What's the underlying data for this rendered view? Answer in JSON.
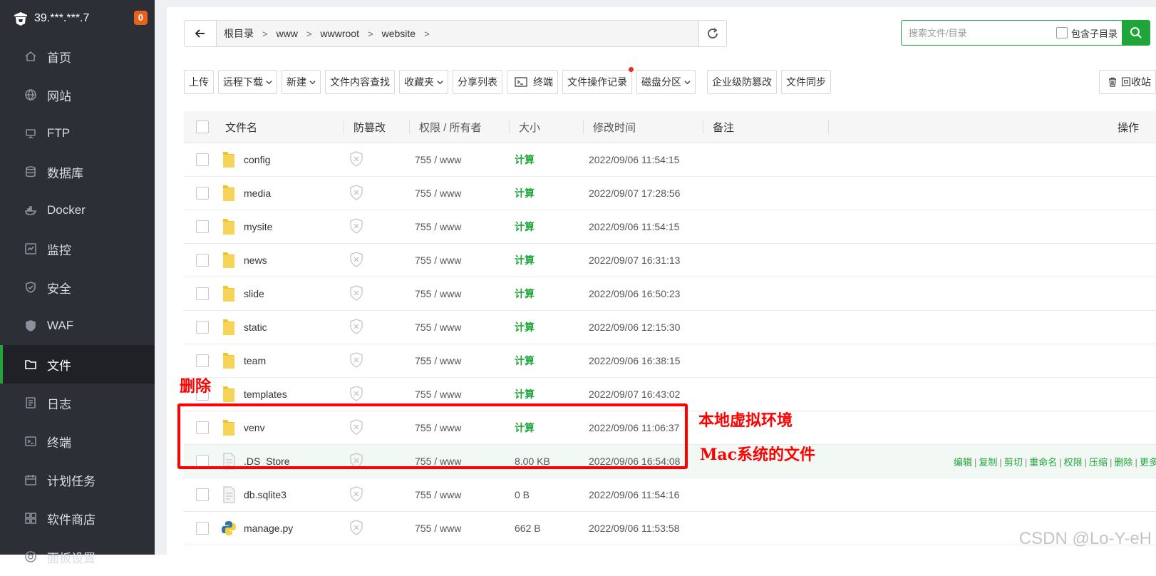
{
  "sidebar": {
    "server_ip": "39.***.***.7",
    "badge": "0",
    "items": [
      {
        "label": "首页",
        "icon": "home-icon"
      },
      {
        "label": "网站",
        "icon": "globe-icon"
      },
      {
        "label": "FTP",
        "icon": "ftp-icon"
      },
      {
        "label": "数据库",
        "icon": "database-icon"
      },
      {
        "label": "Docker",
        "icon": "docker-icon"
      },
      {
        "label": "监控",
        "icon": "monitor-icon"
      },
      {
        "label": "安全",
        "icon": "shield-icon"
      },
      {
        "label": "WAF",
        "icon": "waf-shield-icon"
      },
      {
        "label": "文件",
        "icon": "folder-icon"
      },
      {
        "label": "日志",
        "icon": "log-icon"
      },
      {
        "label": "终端",
        "icon": "terminal-icon"
      },
      {
        "label": "计划任务",
        "icon": "calendar-icon"
      },
      {
        "label": "软件商店",
        "icon": "apps-icon"
      },
      {
        "label": "面板设置",
        "icon": "settings-icon"
      }
    ],
    "active_index": 8
  },
  "path": {
    "crumbs": [
      "根目录",
      "www",
      "wwwroot",
      "website"
    ]
  },
  "search": {
    "placeholder": "搜索文件/目录",
    "include_sub": "包含子目录"
  },
  "toolbar": {
    "upload": "上传",
    "remote_download": "远程下载",
    "new": "新建",
    "content_search": "文件内容查找",
    "favorites": "收藏夹",
    "share_list": "分享列表",
    "terminal": "终端",
    "op_log": "文件操作记录",
    "disk": "磁盘分区",
    "tamper": "企业级防篡改",
    "sync": "文件同步",
    "recycle": "回收站"
  },
  "table": {
    "headers": {
      "name": "文件名",
      "protect": "防篡改",
      "perm": "权限 / 所有者",
      "size": "大小",
      "mtime": "修改时间",
      "note": "备注",
      "ops": "操作"
    },
    "rows": [
      {
        "name": "config",
        "type": "folder",
        "perm": "755 / www",
        "size": "计算",
        "mtime": "2022/09/06 11:54:15"
      },
      {
        "name": "media",
        "type": "folder",
        "perm": "755 / www",
        "size": "计算",
        "mtime": "2022/09/07 17:28:56"
      },
      {
        "name": "mysite",
        "type": "folder",
        "perm": "755 / www",
        "size": "计算",
        "mtime": "2022/09/06 11:54:15"
      },
      {
        "name": "news",
        "type": "folder",
        "perm": "755 / www",
        "size": "计算",
        "mtime": "2022/09/07 16:31:13"
      },
      {
        "name": "slide",
        "type": "folder",
        "perm": "755 / www",
        "size": "计算",
        "mtime": "2022/09/06 16:50:23"
      },
      {
        "name": "static",
        "type": "folder",
        "perm": "755 / www",
        "size": "计算",
        "mtime": "2022/09/06 12:15:30"
      },
      {
        "name": "team",
        "type": "folder",
        "perm": "755 / www",
        "size": "计算",
        "mtime": "2022/09/06 16:38:15"
      },
      {
        "name": "templates",
        "type": "folder",
        "perm": "755 / www",
        "size": "计算",
        "mtime": "2022/09/07 16:43:02"
      },
      {
        "name": "venv",
        "type": "folder",
        "perm": "755 / www",
        "size": "计算",
        "mtime": "2022/09/06 11:06:37"
      },
      {
        "name": ".DS_Store",
        "type": "file",
        "perm": "755 / www",
        "size": "8.00 KB",
        "mtime": "2022/09/06 16:54:08"
      },
      {
        "name": "db.sqlite3",
        "type": "file",
        "perm": "755 / www",
        "size": "0 B",
        "mtime": "2022/09/06 11:54:16"
      },
      {
        "name": "manage.py",
        "type": "python",
        "perm": "755 / www",
        "size": "662 B",
        "mtime": "2022/09/06 11:53:58"
      }
    ],
    "hover_row": 9,
    "row_ops": [
      "编辑",
      "复制",
      "剪切",
      "重命名",
      "权限",
      "压缩",
      "删除",
      "更多"
    ]
  },
  "annotations": {
    "delete": "删除",
    "local_venv": "本地虚拟环境",
    "mac_file": "Mac系统的文件"
  },
  "watermark": "CSDN @Lo-Y-eH",
  "colors": {
    "accent": "#20a53a",
    "sidebar_bg": "#2c2f36",
    "annotation": "#ff0000",
    "badge": "#e8611a"
  }
}
